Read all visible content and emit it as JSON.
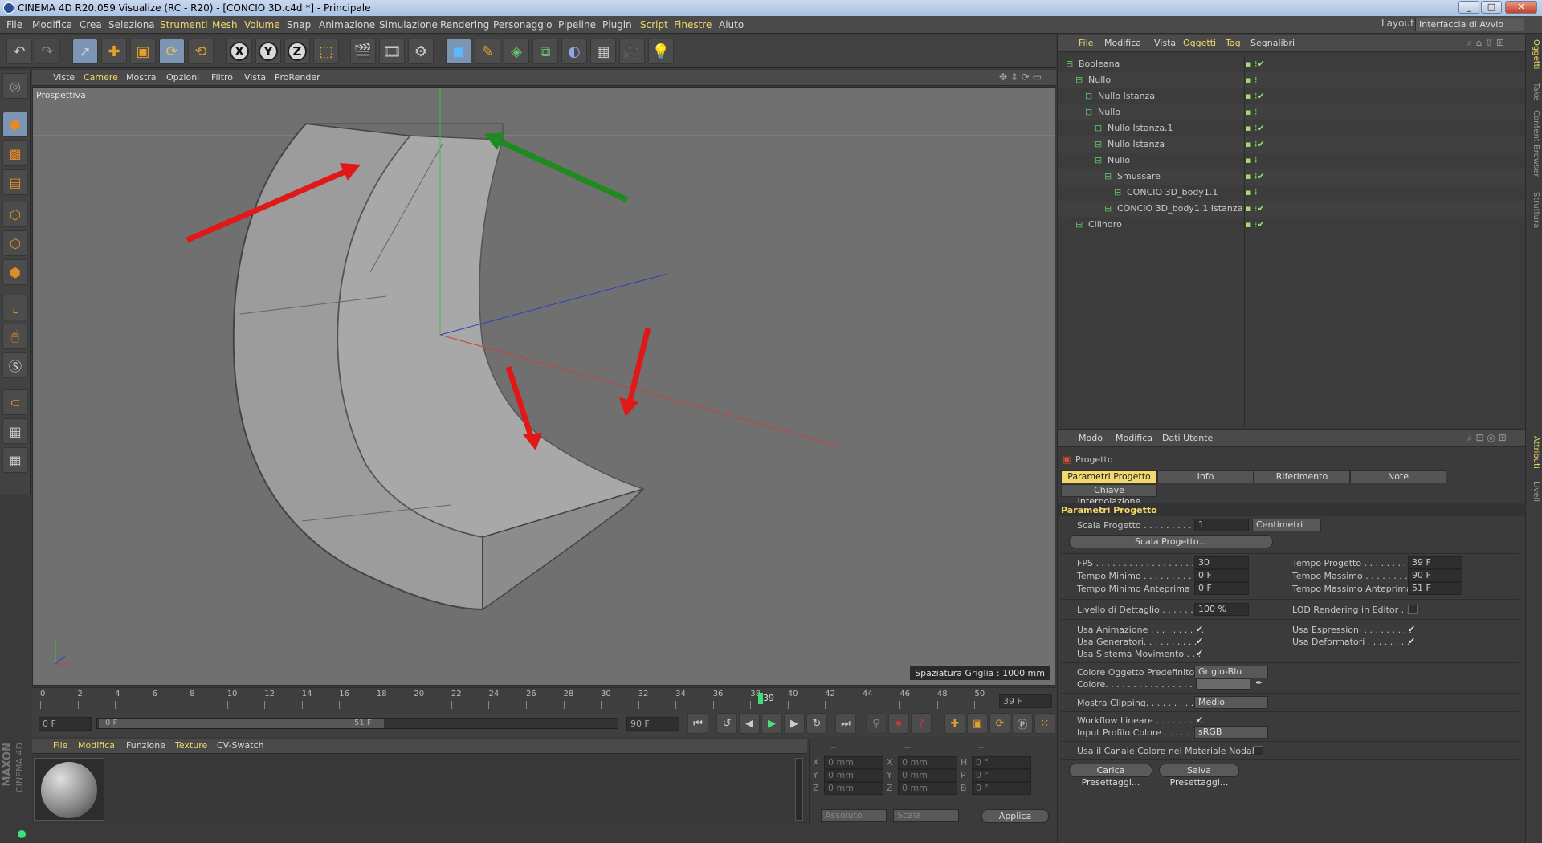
{
  "window": {
    "title": "CINEMA 4D R20.059 Visualize (RC - R20) - [CONCIO 3D.c4d *] - Principale"
  },
  "menubar": {
    "items": [
      "File",
      "Modifica",
      "Crea",
      "Seleziona",
      "Strumenti",
      "Mesh",
      "Volume",
      "Snap",
      "Animazione",
      "Simulazione",
      "Rendering",
      "Personaggio",
      "Pipeline",
      "Plugin",
      "Script",
      "Finestre",
      "Aiuto"
    ],
    "layout_label": "Layout:",
    "layout_value": "Interfaccia di Avvio"
  },
  "toolbar": {
    "axis_x": "X",
    "axis_y": "Y",
    "axis_z": "Z"
  },
  "viewport": {
    "menu": [
      "Viste",
      "Camere",
      "Mostra",
      "Opzioni",
      "Filtro",
      "Vista",
      "ProRender"
    ],
    "camera_label": "Prospettiva",
    "grid_label": "Spaziatura Griglia : 1000 mm"
  },
  "timeline": {
    "ticks": [
      "0",
      "2",
      "4",
      "6",
      "8",
      "10",
      "12",
      "14",
      "16",
      "18",
      "20",
      "22",
      "24",
      "26",
      "28",
      "30",
      "32",
      "34",
      "36",
      "38",
      "40",
      "42",
      "44",
      "46",
      "48",
      "50"
    ],
    "current_frame_marker": "39",
    "current_frame_field": "39 F",
    "start_field": "0 F",
    "range_start": "0 F",
    "range_end": "51 F",
    "end_field": "90 F"
  },
  "materials": {
    "menu": [
      "File",
      "Modifica",
      "Funzione",
      "Texture",
      "CV-Swatch"
    ]
  },
  "coords": {
    "header": [
      "--",
      "--",
      "--"
    ],
    "rows": [
      {
        "a": "X",
        "av": "0 mm",
        "b": "X",
        "bv": "0 mm",
        "c": "H",
        "cv": "0 °"
      },
      {
        "a": "Y",
        "av": "0 mm",
        "b": "Y",
        "bv": "0 mm",
        "c": "P",
        "cv": "0 °"
      },
      {
        "a": "Z",
        "av": "0 mm",
        "b": "Z",
        "bv": "0 mm",
        "c": "B",
        "cv": "0 °"
      }
    ],
    "mode1": "Assoluto",
    "mode2": "Scala",
    "apply": "Applica"
  },
  "branding": {
    "maxon": "MAXON",
    "cinema": "CINEMA 4D"
  },
  "object_manager": {
    "menu": [
      "File",
      "Modifica",
      "Vista",
      "Oggetti",
      "Tag",
      "Segnalibri"
    ],
    "objects": [
      {
        "name": "Booleana",
        "indent": 0,
        "check": true
      },
      {
        "name": "Nullo",
        "indent": 1,
        "check": false
      },
      {
        "name": "Nullo Istanza",
        "indent": 2,
        "check": true
      },
      {
        "name": "Nullo",
        "indent": 2,
        "check": false
      },
      {
        "name": "Nullo Istanza.1",
        "indent": 3,
        "check": true
      },
      {
        "name": "Nullo Istanza",
        "indent": 3,
        "check": true
      },
      {
        "name": "Nullo",
        "indent": 3,
        "check": false
      },
      {
        "name": "Smussare",
        "indent": 4,
        "check": true
      },
      {
        "name": "CONCIO 3D_body1.1",
        "indent": 5,
        "check": false
      },
      {
        "name": "CONCIO 3D_body1.1 Istanza",
        "indent": 4,
        "check": true
      },
      {
        "name": "Cilindro",
        "indent": 1,
        "check": true
      }
    ]
  },
  "attributes": {
    "menu": [
      "Modo",
      "Modifica",
      "Dati Utente"
    ],
    "object_title": "Progetto",
    "tabs": [
      "Parametri Progetto",
      "Info",
      "Riferimento",
      "Note"
    ],
    "tab2": "Chiave Interpolazione",
    "section": "Parametri Progetto",
    "scala_label": "Scala Progetto . . . . . . . . . . .",
    "scala_value": "1",
    "scala_unit": "Centimetri",
    "scala_button": "Scala Progetto...",
    "fps_label": "FPS . . . . . . . . . . . . . . . . . . . . . . .",
    "fps_value": "30",
    "tmin_label": "Tempo Minimo . . . . . . . . . . . . .",
    "tmin_value": "0 F",
    "tminp_label": "Tempo Minimo Anteprima",
    "tminp_value": "0 F",
    "tprog_label": "Tempo Progetto . . . . . . . . .",
    "tprog_value": "39 F",
    "tmax_label": "Tempo Massimo . . . . . . . . .",
    "tmax_value": "90 F",
    "tmaxp_label": "Tempo Massimo Anteprima",
    "tmaxp_value": "51 F",
    "lod_label": "Livello di Dettaglio . . . . . .",
    "lod_value": "100 %",
    "lodr_label": "LOD Rendering in Editor . .",
    "anim_label": "Usa Animazione . . . . . . . . . .",
    "gen_label": "Usa Generatori. . . . . . . . . . .",
    "sys_label": "Usa Sistema Movimento . . .",
    "expr_label": "Usa Espressioni . . . . . . . . .",
    "def_label": "Usa Deformatori . . . . . . . .",
    "color_def_label": "Colore Oggetto Predefinito",
    "color_def_value": "Grigio-Blu",
    "color_label": "Colore. . . . . . . . . . . . . . . . . . . .",
    "clip_label": "Mostra Clipping. . . . . . . . . . .",
    "clip_value": "Medio",
    "wf_label": "Workflow Lineare . . . . . . . . .",
    "prof_label": "Input Profilo Colore . . . . . .",
    "prof_value": "sRGB",
    "nodal_label": "Usa il Canale Colore nel Materiale Nodale",
    "load_button": "Carica Presettaggi...",
    "save_button": "Salva Presettaggi..."
  },
  "side_tabs": [
    "Oggetti",
    "Take",
    "Content Browser",
    "Struttura",
    "Attributi",
    "Livelli"
  ],
  "colors": {
    "accent": "#f3d86c",
    "viewport": "#707070",
    "panel": "#3c3c3c"
  }
}
